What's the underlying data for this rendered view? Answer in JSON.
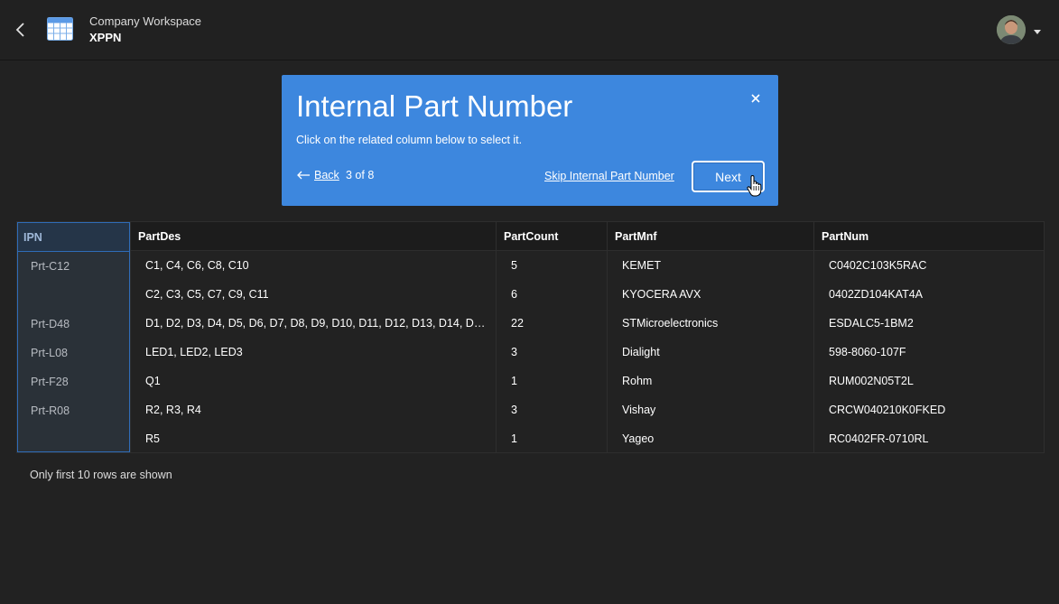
{
  "header": {
    "workspace_name": "Company Workspace",
    "title": "XPPN"
  },
  "wizard": {
    "title": "Internal Part Number",
    "subtitle": "Click on the related column below to select it.",
    "back_label": "Back",
    "step": "3 of 8",
    "skip_label": "Skip Internal Part Number",
    "next_label": "Next"
  },
  "table": {
    "columns": [
      "IPN",
      "PartDes",
      "PartCount",
      "PartMnf",
      "PartNum"
    ],
    "rows": [
      [
        "Prt-C12",
        "C1, C4, C6, C8, C10",
        "5",
        "KEMET",
        "C0402C103K5RAC"
      ],
      [
        "",
        "C2, C3, C5, C7, C9, C11",
        "6",
        "KYOCERA AVX",
        "0402ZD104KAT4A"
      ],
      [
        "Prt-D48",
        "D1, D2, D3, D4, D5, D6, D7, D8, D9, D10, D11, D12, D13, D14, D15,...",
        "22",
        "STMicroelectronics",
        "ESDALC5-1BM2"
      ],
      [
        "Prt-L08",
        "LED1, LED2, LED3",
        "3",
        "Dialight",
        "598-8060-107F"
      ],
      [
        "Prt-F28",
        "Q1",
        "1",
        "Rohm",
        "RUM002N05T2L"
      ],
      [
        "Prt-R08",
        "R2, R3, R4",
        "3",
        "Vishay",
        "CRCW040210K0FKED"
      ],
      [
        "",
        "R5",
        "1",
        "Yageo",
        "RC0402FR-0710RL"
      ]
    ]
  },
  "footnote": "Only first 10 rows are shown",
  "colors": {
    "background": "#222222",
    "wizard_blue": "#3d87de",
    "selected_column_border": "#2f6cb8"
  },
  "icons": [
    "back-arrow-icon",
    "spreadsheet-icon",
    "avatar",
    "caret-down-icon",
    "close-icon",
    "arrow-left-icon",
    "hand-pointer-icon"
  ]
}
